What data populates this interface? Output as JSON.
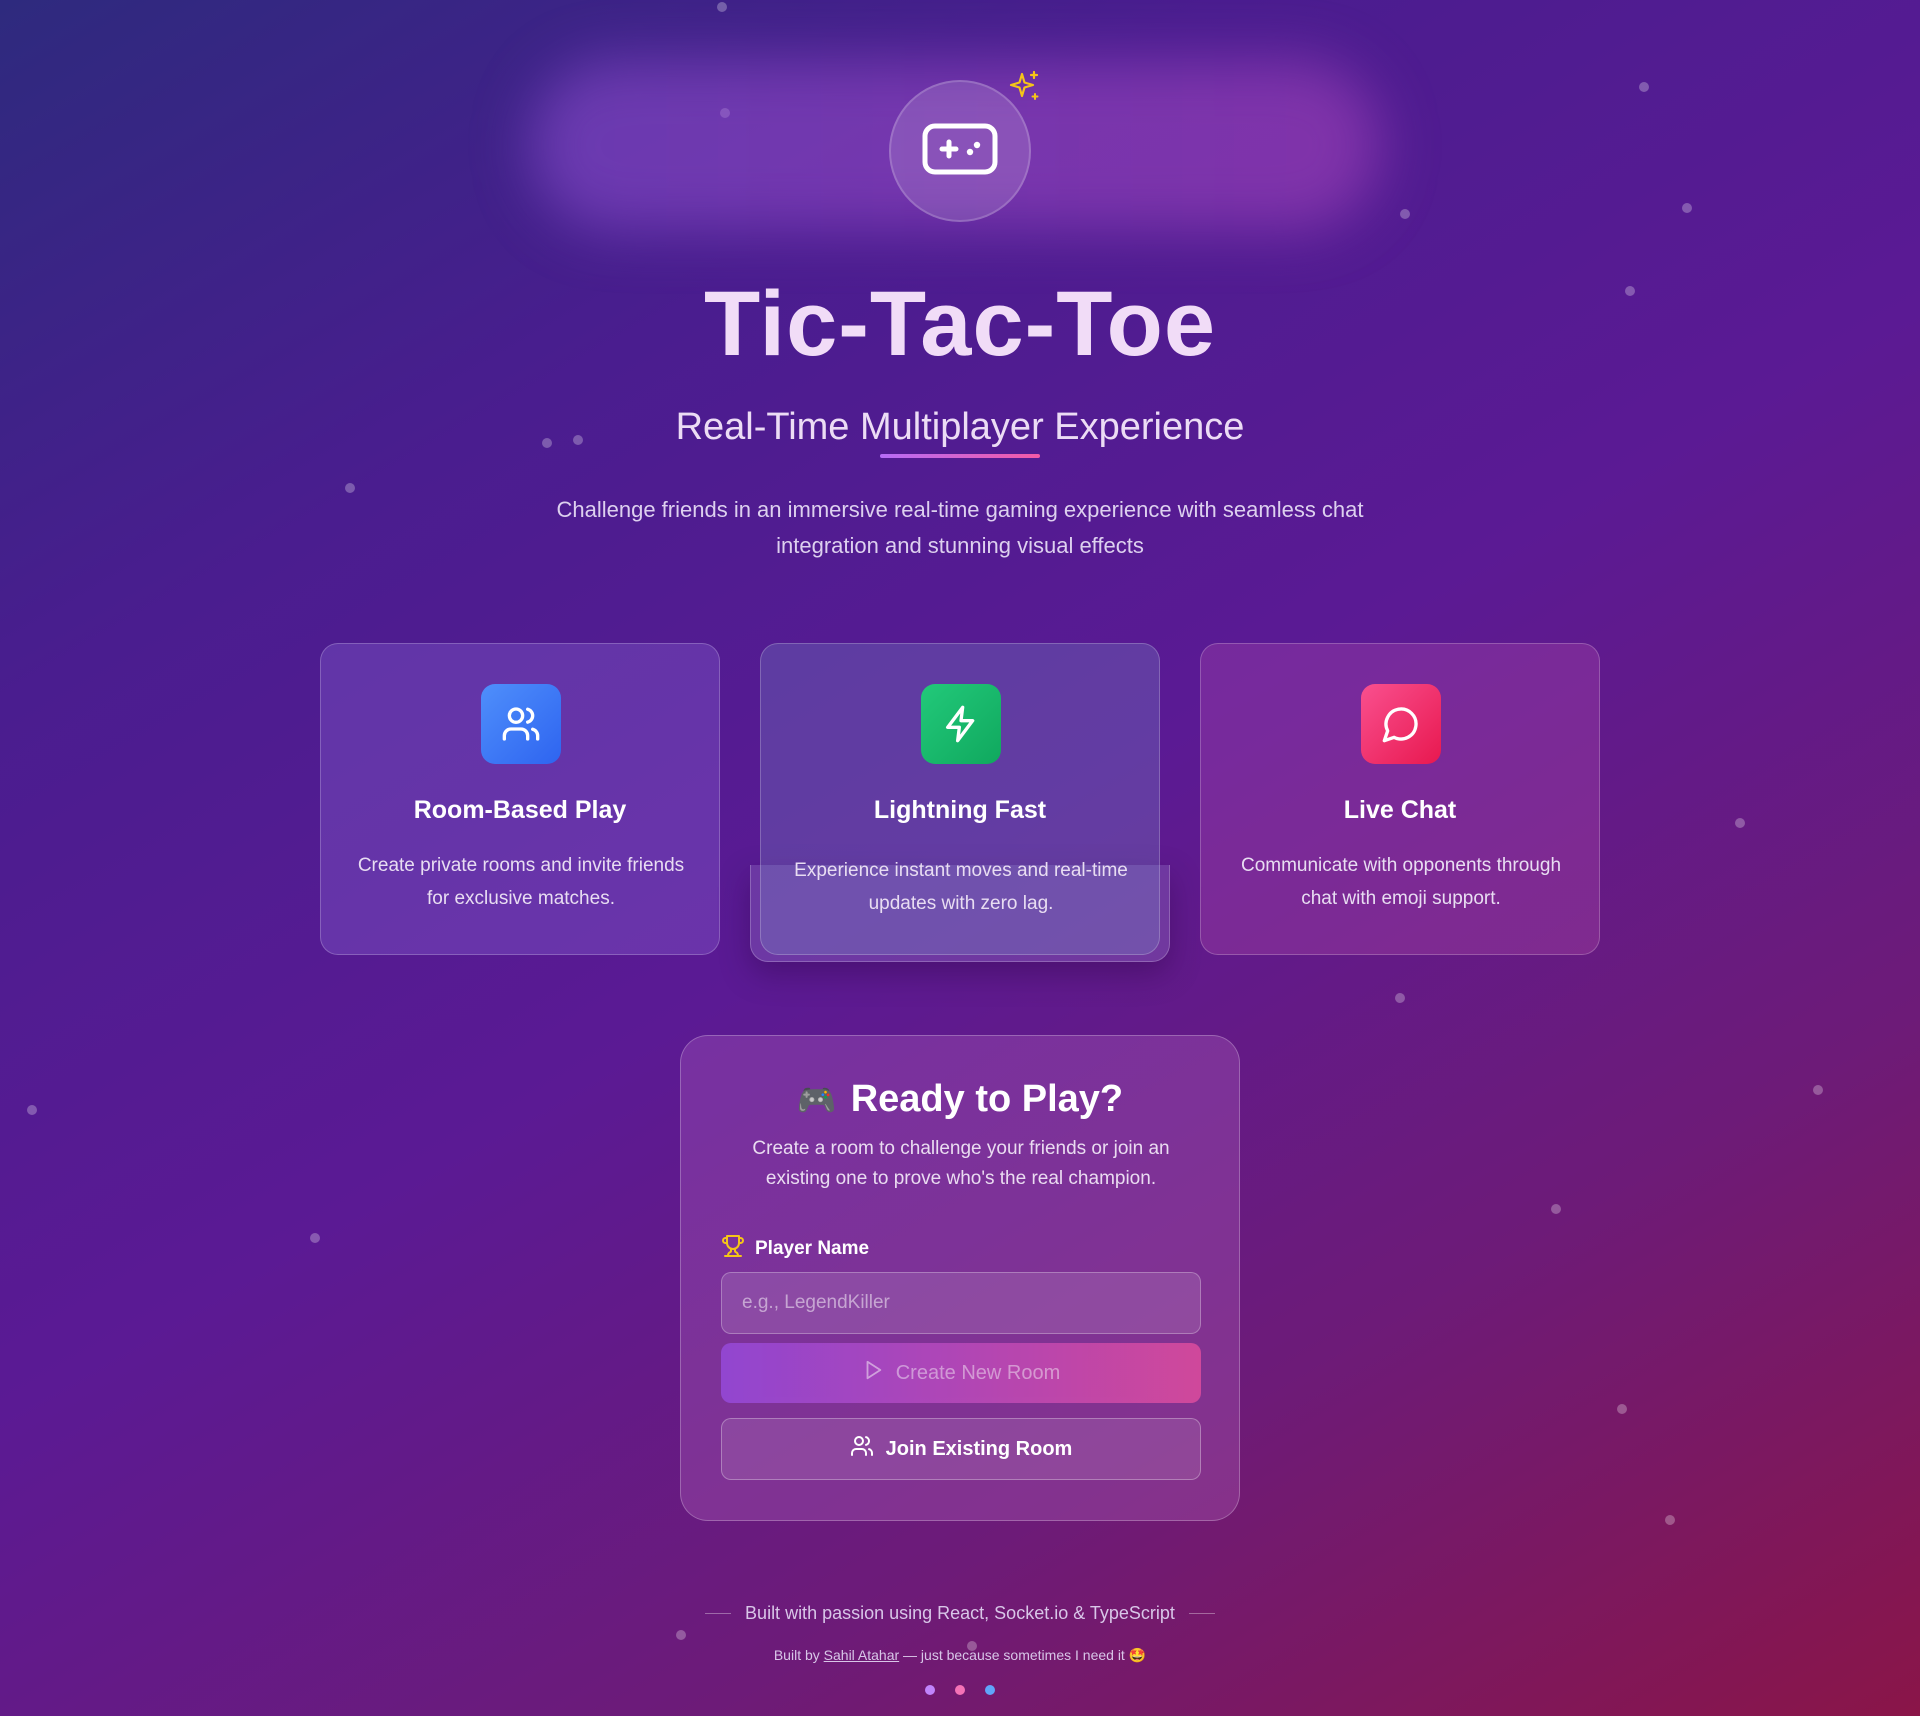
{
  "hero": {
    "title": "Tic-Tac-Toe",
    "subtitle": "Real-Time Multiplayer Experience",
    "description": "Challenge friends in an immersive real-time gaming experience with seamless chat integration and stunning visual effects",
    "logo_icon": "gamepad-icon",
    "sparkle_icon": "sparkles-icon"
  },
  "features": [
    {
      "title": "Room-Based Play",
      "description": "Create private rooms and invite friends for exclusive matches.",
      "icon": "users-icon",
      "color": "#3b7bf6"
    },
    {
      "title": "Lightning Fast",
      "description": "Experience instant moves and real-time updates with zero lag.",
      "icon": "lightning-icon",
      "color": "#16b86b"
    },
    {
      "title": "Live Chat",
      "description": "Communicate with opponents through chat with emoji support.",
      "icon": "chat-bubble-icon",
      "color": "#f0306a"
    }
  ],
  "panel": {
    "emoji": "🎮",
    "title": "Ready to Play?",
    "description": "Create a room to challenge your friends or join an existing one to prove who's the real champion.",
    "player_label": "Player Name",
    "player_placeholder": "e.g., LegendKiller",
    "create_label": "Create New Room",
    "join_label": "Join Existing Room"
  },
  "footer": {
    "line1": "Built with passion using React, Socket.io & TypeScript",
    "built_by_prefix": "Built by",
    "author": "Sahil Atahar",
    "built_by_suffix": "— just because sometimes I need it 🤩",
    "dot_colors": [
      "#c084fc",
      "#f472b6",
      "#60a5fa"
    ]
  }
}
